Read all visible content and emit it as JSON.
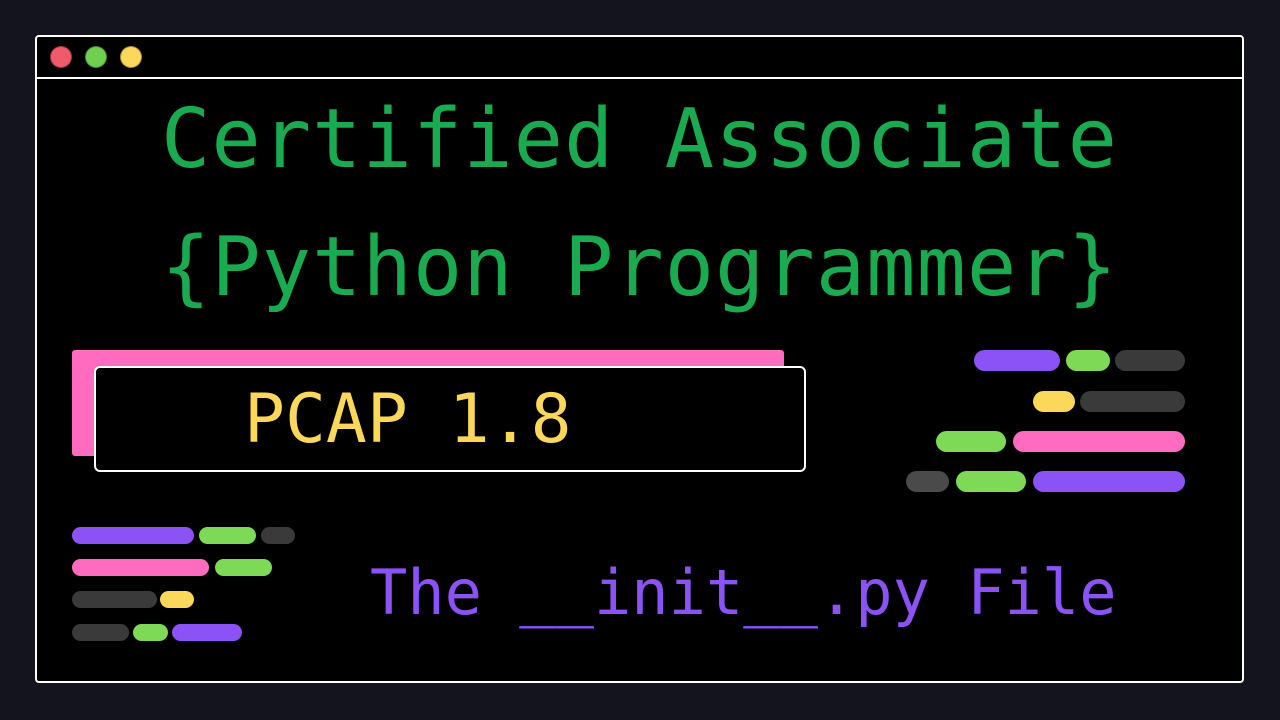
{
  "title": {
    "line1": "Certified Associate",
    "line2": "{Python Programmer}"
  },
  "badge": {
    "label": "PCAP 1.8"
  },
  "subtitle": "The __init__.py File",
  "window_controls": [
    {
      "name": "close-dot",
      "color": "#f05a6a"
    },
    {
      "name": "minimize-dot",
      "color": "#6fcf4f"
    },
    {
      "name": "maximize-dot",
      "color": "#fbd85a"
    }
  ],
  "colors": {
    "title": "#1aaa50",
    "badge_text": "#fbd85a",
    "badge_accent": "#ff6cbf",
    "subtitle": "#8b52f5",
    "purple": "#8b52f5",
    "green": "#7ed957",
    "gray": "#3a3a3a",
    "pink": "#ff6cbf",
    "yellow": "#fbd85a"
  }
}
